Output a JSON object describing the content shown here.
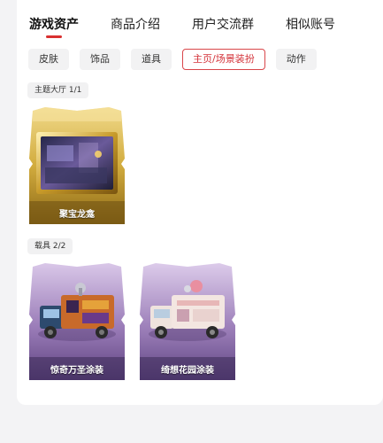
{
  "top_tabs": [
    {
      "label": "游戏资产",
      "active": true
    },
    {
      "label": "商品介绍",
      "active": false
    },
    {
      "label": "用户交流群",
      "active": false
    },
    {
      "label": "相似账号",
      "active": false
    }
  ],
  "category_chips": [
    {
      "label": "皮肤",
      "active": false
    },
    {
      "label": "饰品",
      "active": false
    },
    {
      "label": "道具",
      "active": false
    },
    {
      "label": "主页/场景装扮",
      "active": true
    },
    {
      "label": "动作",
      "active": false
    }
  ],
  "sections": [
    {
      "label": "主题大厅 1/1",
      "items": [
        {
          "name": "聚宝龙龛",
          "icon": "gold-frame-theme-lobby-artwork"
        }
      ]
    },
    {
      "label": "载具 2/2",
      "items": [
        {
          "name": "惊奇万圣涂装",
          "icon": "halloween-truck-artwork"
        },
        {
          "name": "绮想花园涂装",
          "icon": "garden-truck-artwork"
        }
      ]
    }
  ],
  "colors": {
    "accent": "#d93030",
    "gold_card": "#c9a43a",
    "purple_card": "#8a6aa8"
  }
}
